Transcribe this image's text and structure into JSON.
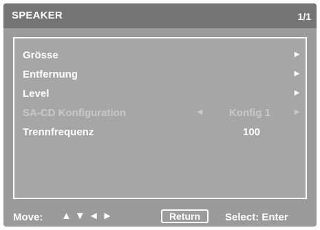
{
  "header": {
    "title": "SPEAKER",
    "page": "1/1"
  },
  "menu": {
    "items": [
      {
        "label": "Grösse",
        "arrow": "►"
      },
      {
        "label": "Entfernung",
        "arrow": "►"
      },
      {
        "label": "Level",
        "arrow": "►"
      },
      {
        "label": "SA-CD Konfiguration",
        "arrow_left": "◄",
        "value": "Konfig 1",
        "arrow_right": "►",
        "disabled": true
      },
      {
        "label": "Trennfrequenz",
        "value": "100"
      }
    ]
  },
  "footer": {
    "move_label": "Move:",
    "move_arrows": "▲▼◄►",
    "return_label": "Return",
    "select_label": "Select: Enter"
  },
  "colors": {
    "screen_bg": "#9b9b9b",
    "header_bg": "#747474",
    "panel_bg": "#a6a6a6",
    "text": "#ffffff",
    "disabled_text": "#c9c9c9"
  }
}
